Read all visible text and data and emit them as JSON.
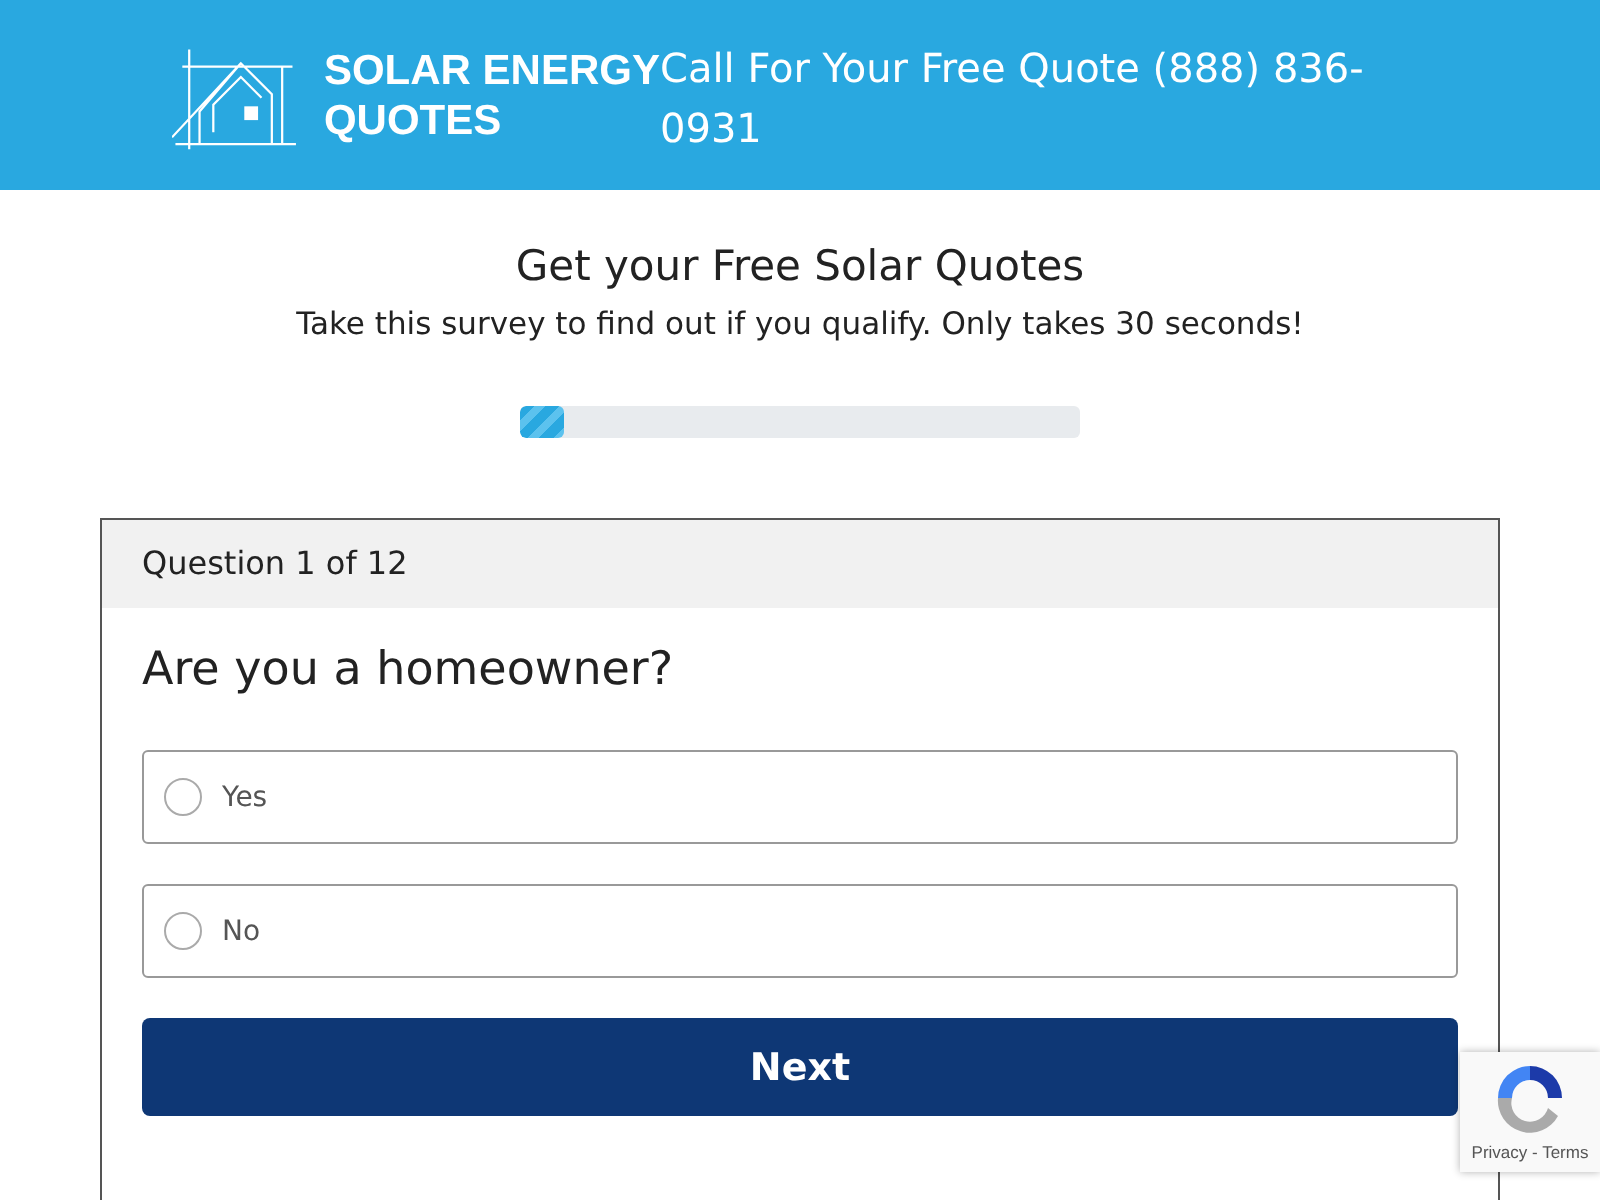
{
  "header": {
    "logo_lines": [
      "SOLAR ENERGY",
      "QUOTES"
    ],
    "phone_text": "Call For Your Free Quote (888) 836-0931"
  },
  "intro": {
    "title": "Get your Free Solar Quotes",
    "subtitle": "Take this survey to find out if you qualify. Only takes 30 seconds!"
  },
  "progress": {
    "level": 0.08
  },
  "question": {
    "counter": "Question 1 of 12",
    "text": "Are you a homeowner?",
    "options": [
      {
        "label": "Yes",
        "selected": false
      },
      {
        "label": "No",
        "selected": false
      }
    ],
    "next_button": "Next"
  },
  "recaptcha": {
    "links": "Privacy - Terms"
  }
}
